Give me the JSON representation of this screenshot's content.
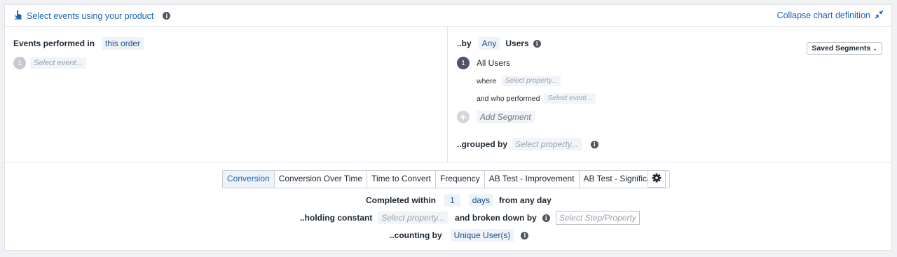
{
  "header": {
    "title": "Select events using your product",
    "collapse_label": "Collapse chart definition"
  },
  "events_panel": {
    "label": "Events performed in",
    "order_chip": "this order",
    "step_number": "1",
    "event_placeholder": "Select event..."
  },
  "segment_panel": {
    "by_label": "..by",
    "any_chip": "Any",
    "users_label": "Users",
    "saved_segments_label": "Saved Segments",
    "segment_number": "1",
    "segment_name": "All Users",
    "where_label": "where",
    "where_placeholder": "Select property...",
    "who_performed_label": "and who performed",
    "who_performed_placeholder": "Select event...",
    "add_segment_label": "Add Segment",
    "grouped_by_label": "..grouped by",
    "grouped_by_placeholder": "Select property..."
  },
  "tabs": [
    {
      "label": "Conversion",
      "active": true
    },
    {
      "label": "Conversion Over Time",
      "active": false
    },
    {
      "label": "Time to Convert",
      "active": false
    },
    {
      "label": "Frequency",
      "active": false
    },
    {
      "label": "AB Test - Improvement",
      "active": false
    },
    {
      "label": "AB Test - Significance",
      "active": false
    }
  ],
  "settings": {
    "completed_within_label": "Completed within",
    "completed_value": "1",
    "completed_unit": "days",
    "completed_suffix": "from any day",
    "holding_constant_label": "..holding constant",
    "holding_constant_placeholder": "Select property...",
    "broken_down_label": "and broken down by",
    "broken_down_placeholder": "Select Step/Property",
    "counting_by_label": "..counting by",
    "counting_by_value": "Unique User(s)"
  },
  "colors": {
    "accent": "#1a62b5",
    "chip_bg": "#eef3f9"
  }
}
